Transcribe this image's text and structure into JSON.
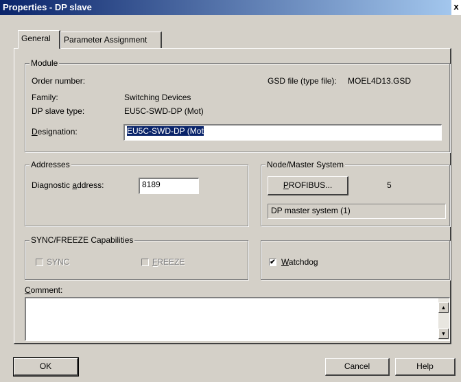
{
  "window": {
    "title": "Properties - DP slave",
    "close": "x"
  },
  "tabs": [
    {
      "label": "General",
      "active": true
    },
    {
      "label": "Parameter Assignment",
      "active": false
    }
  ],
  "module": {
    "legend": "Module",
    "order_number_label": "Order number:",
    "gsd_file_label": "GSD file (type file):",
    "gsd_file_value": "MOEL4D13.GSD",
    "family_label": "Family:",
    "family_value": "Switching Devices",
    "dp_slave_type_label": "DP slave type:",
    "dp_slave_type_value": "EU5C-SWD-DP (Mot)",
    "designation_label": "Designation:",
    "designation_value": "EU5C-SWD-DP (Mot"
  },
  "addresses": {
    "legend": "Addresses",
    "diagnostic_label": "Diagnostic address:",
    "diagnostic_value": "8189"
  },
  "node_master": {
    "legend": "Node/Master System",
    "profibus_button": "PROFIBUS...",
    "profibus_address": "5",
    "master_system": "DP master system (1)"
  },
  "sync_freeze": {
    "legend": "SYNC/FREEZE Capabilities",
    "sync_label": "SYNC",
    "sync_checked": false,
    "freeze_label": "FREEZE",
    "freeze_checked": false
  },
  "watchdog": {
    "label": "Watchdog",
    "checked": true,
    "mark": "✔"
  },
  "comment": {
    "label": "Comment:",
    "value": ""
  },
  "buttons": {
    "ok": "OK",
    "cancel": "Cancel",
    "help": "Help"
  },
  "colors": {
    "title_bar": "#0a246a",
    "face": "#d4d0c8",
    "selection": "#0a246a"
  }
}
